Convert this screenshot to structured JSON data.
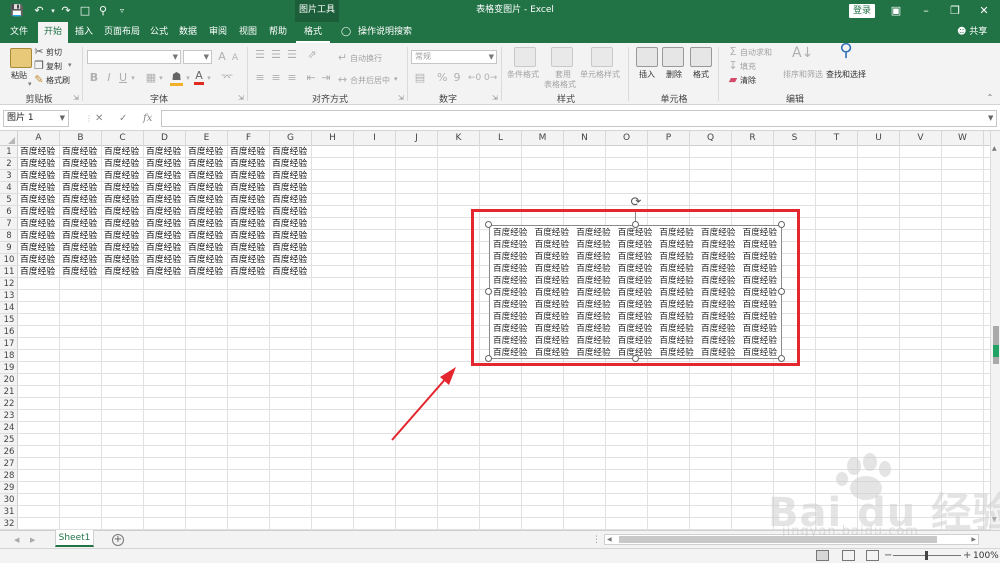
{
  "titlebar": {
    "context_tools": "图片工具",
    "doc_title": "表格变图片 - Excel",
    "login": "登录"
  },
  "tabs": [
    "文件",
    "开始",
    "插入",
    "页面布局",
    "公式",
    "数据",
    "审阅",
    "视图",
    "帮助",
    "格式"
  ],
  "active_tab": "开始",
  "tell_me": "操作说明搜索",
  "share": "共享",
  "ribbon": {
    "clipboard": {
      "paste": "粘贴",
      "cut": "剪切",
      "copy": "复制",
      "format_painter": "格式刷",
      "label": "剪贴板"
    },
    "font": {
      "label": "字体",
      "bold": "B",
      "italic": "I",
      "underline": "U",
      "grow": "A",
      "shrink": "A"
    },
    "alignment": {
      "wrap": "自动换行",
      "merge": "合并后居中",
      "label": "对齐方式"
    },
    "number": {
      "format": "常规",
      "percent": "%",
      "comma": "9",
      "label": "数字"
    },
    "styles": {
      "conditional": "条件格式",
      "table_line1": "套用",
      "table_line2": "表格格式",
      "cell_styles": "单元格样式",
      "label": "样式"
    },
    "cells": {
      "insert": "插入",
      "delete": "删除",
      "format": "格式",
      "label": "单元格"
    },
    "editing": {
      "autosum": "自动求和",
      "fill": "填充",
      "clear": "清除",
      "sort": "排序和筛选",
      "find": "查找和选择",
      "label": "编辑"
    }
  },
  "formula_bar": {
    "name_box": "图片 1",
    "fx": "fx",
    "cancel": "✕",
    "confirm": "✓",
    "value": ""
  },
  "columns": [
    "A",
    "B",
    "C",
    "D",
    "E",
    "F",
    "G",
    "H",
    "I",
    "J",
    "K",
    "L",
    "M",
    "N",
    "O",
    "P",
    "Q",
    "R",
    "S",
    "T",
    "U",
    "V",
    "W"
  ],
  "rows": [
    "1",
    "2",
    "3",
    "4",
    "5",
    "6",
    "7",
    "8",
    "9",
    "10",
    "11",
    "12",
    "13",
    "14",
    "15",
    "16",
    "17",
    "18",
    "19",
    "20",
    "21",
    "22",
    "23",
    "24",
    "25",
    "26",
    "27",
    "28",
    "29",
    "30",
    "31",
    "32"
  ],
  "cell_text": "百度经验",
  "data_block": {
    "rows": 11,
    "cols": 7
  },
  "picture": {
    "rows": 11,
    "cols": 7,
    "cell_text": "百度经验"
  },
  "sheet_tab": "Sheet1",
  "add_sheet": "+",
  "status": {
    "zoom": "100%",
    "zoom_minus": "−",
    "zoom_plus": "+"
  },
  "watermark": {
    "brand": "Bai du 经验",
    "url": "jingyan.baidu.com"
  },
  "colors": {
    "excel_green": "#217346",
    "highlight_red": "#e4262e",
    "ribbon_bg": "#f3f3f3"
  }
}
